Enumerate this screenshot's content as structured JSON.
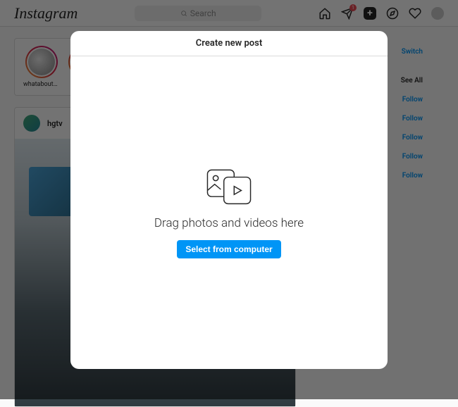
{
  "topbar": {
    "logo": "Instagram",
    "search_placeholder": "Search",
    "message_badge": "1"
  },
  "stories": [
    {
      "name": "whataboutb..."
    },
    {
      "name": ""
    }
  ],
  "post": {
    "username": "hgtv"
  },
  "sidebar": {
    "switch": "Switch",
    "see_all": "See All",
    "follow_labels": [
      "Follow",
      "Follow",
      "Follow",
      "Follow",
      "Follow"
    ]
  },
  "modal": {
    "title": "Create new post",
    "drag_text": "Drag photos and videos here",
    "select_button": "Select from computer"
  }
}
